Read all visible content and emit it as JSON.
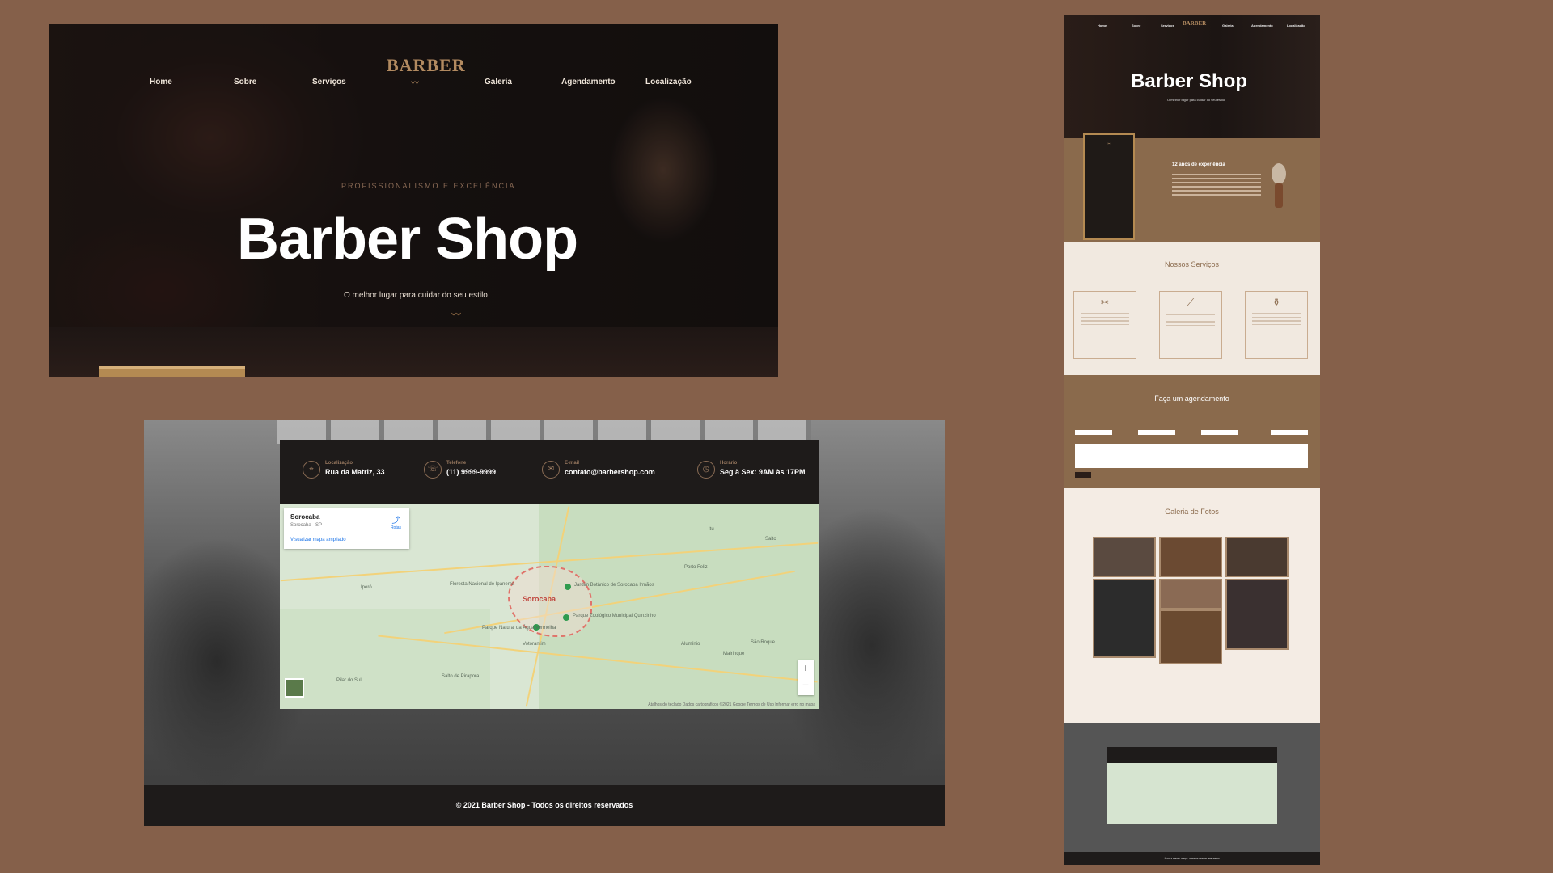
{
  "hero": {
    "nav": [
      "Home",
      "Sobre",
      "Serviços",
      "Galeria",
      "Agendamento",
      "Localização"
    ],
    "logo_word": "BARBER",
    "kicker": "PROFISSIONALISMO E EXCELÊNCIA",
    "title": "Barber Shop",
    "subtitle": "O melhor lugar para cuidar do seu estilo"
  },
  "contact": {
    "items": [
      {
        "label": "Localização",
        "value": "Rua da Matriz, 33",
        "icon": "location-pin-icon"
      },
      {
        "label": "Telefone",
        "value": "(11) 9999-9999",
        "icon": "phone-icon"
      },
      {
        "label": "E-mail",
        "value": "contato@barbershop.com",
        "icon": "mail-icon"
      },
      {
        "label": "Horário",
        "value": "Seg à Sex: 9AM às 17PM",
        "icon": "clock-icon"
      }
    ],
    "map": {
      "place_name": "Sorocaba",
      "place_region": "Sorocaba - SP",
      "expanded_link": "Visualizar mapa ampliado",
      "directions": "Rotas",
      "city_label": "Sorocaba",
      "places": [
        "Jardim Botânico de Sorocaba Irmãos",
        "Parque Natural da Água Vermelha",
        "Parque Zoológico Municipal Quinzinho",
        "Floresta Nacional de Ipanema",
        "Alumínio",
        "São Roque",
        "Mairinque",
        "Votorantim",
        "Salto de Pirapora",
        "Itu",
        "Porto Feliz",
        "Iperó",
        "Salto",
        "Pilar do Sul"
      ],
      "attribution": "Atalhos do teclado   Dados cartográficos ©2021 Google   Termos de Uso   Informar erro no mapa"
    },
    "footer": "© 2021 Barber Shop - Todos os direitos reservados"
  },
  "preview": {
    "title": "Barber Shop",
    "subtitle": "O melhor lugar para cuidar do seu estilo",
    "about_heading": "12 anos de experiência",
    "services_heading": "Nossos Serviços",
    "booking_heading": "Faça um agendamento",
    "gallery_heading": "Galeria de Fotos"
  },
  "colors": {
    "background": "#85604a",
    "accent": "#8a6a4c",
    "dark": "#1e1b1a"
  }
}
